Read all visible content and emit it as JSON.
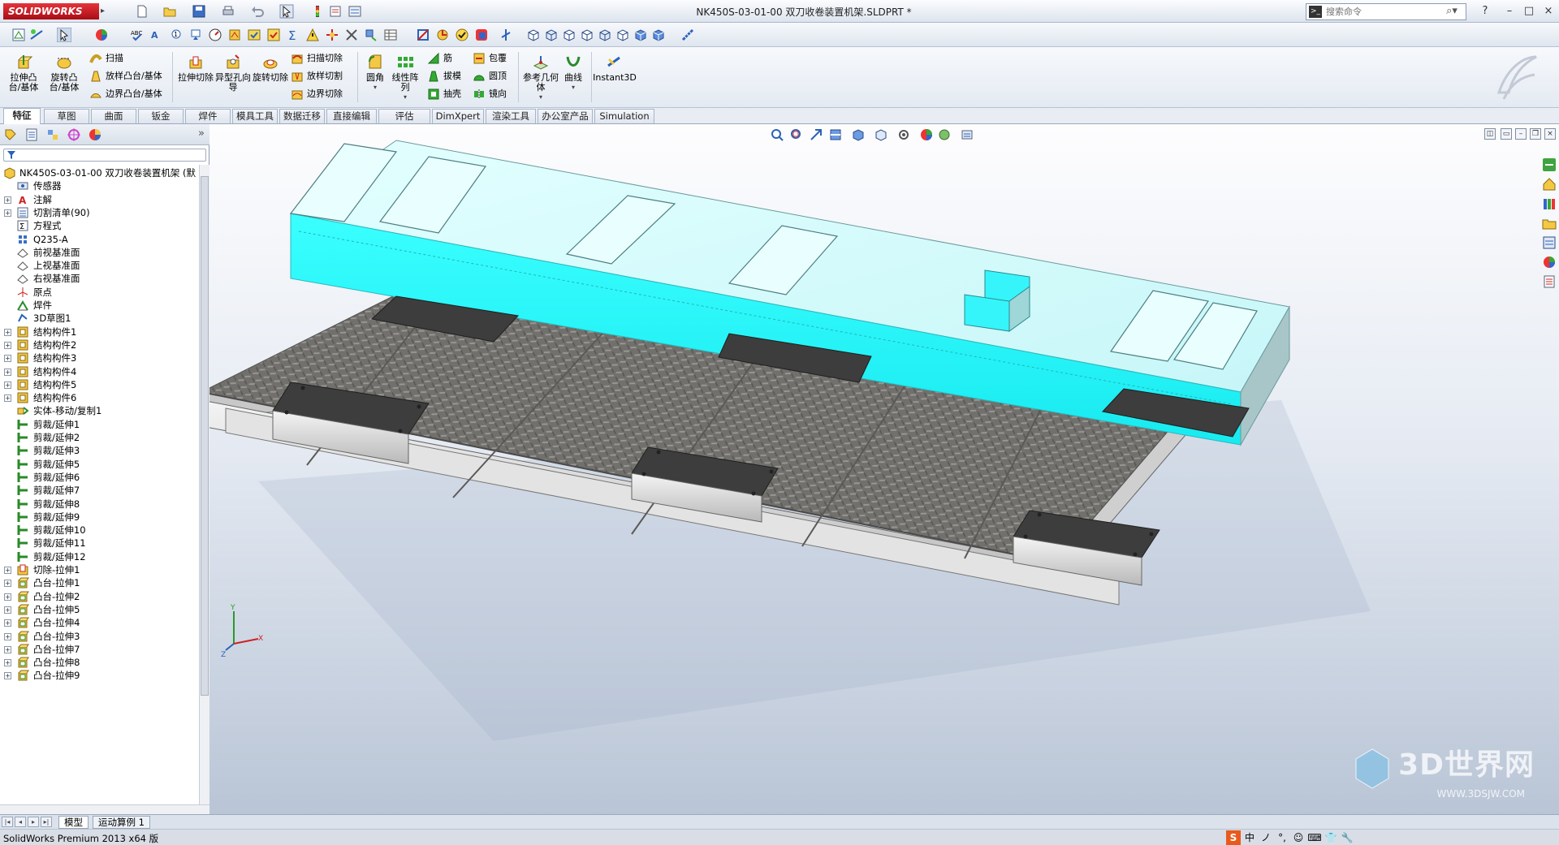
{
  "titlebar": {
    "logo": "SOLIDWORKS",
    "document_title": "NK450S-03-01-00 双刀收卷装置机架.SLDPRT *",
    "search_placeholder": "搜索命令",
    "window_controls": [
      "?",
      "–",
      "□",
      "×"
    ]
  },
  "command_manager": {
    "big_buttons": [
      {
        "label": "拉伸凸台/基体",
        "icon": "extrude-boss-icon"
      },
      {
        "label": "旋转凸台/基体",
        "icon": "revolve-boss-icon"
      },
      {
        "label": "拉伸切除",
        "icon": "extrude-cut-icon"
      },
      {
        "label": "异型孔向导",
        "icon": "hole-wizard-icon"
      },
      {
        "label": "旋转切除",
        "icon": "revolve-cut-icon"
      },
      {
        "label": "圆角",
        "icon": "fillet-icon"
      },
      {
        "label": "线性阵列",
        "icon": "linear-pattern-icon"
      },
      {
        "label": "参考几何体",
        "icon": "reference-geometry-icon"
      },
      {
        "label": "曲线",
        "icon": "curves-icon"
      },
      {
        "label": "Instant3D",
        "icon": "instant3d-icon"
      }
    ],
    "small_buttons": {
      "sweep": "扫描",
      "loft": "放样凸台/基体",
      "boundary": "边界凸台/基体",
      "swept_cut": "扫描切除",
      "lofted_cut": "放样切割",
      "boundary_cut": "边界切除",
      "rib": "筋",
      "draft": "拔模",
      "shell": "抽壳",
      "wrap": "包覆",
      "dome": "圆顶",
      "mirror": "镜向"
    }
  },
  "tabs": [
    {
      "label": "特征",
      "active": true
    },
    {
      "label": "草图"
    },
    {
      "label": "曲面"
    },
    {
      "label": "钣金"
    },
    {
      "label": "焊件"
    },
    {
      "label": "模具工具"
    },
    {
      "label": "数据迁移"
    },
    {
      "label": "直接编辑"
    },
    {
      "label": "评估"
    },
    {
      "label": "DimXpert"
    },
    {
      "label": "渲染工具"
    },
    {
      "label": "办公室产品"
    },
    {
      "label": "Simulation"
    }
  ],
  "feature_tree": {
    "root": "NK450S-03-01-00 双刀收卷装置机架 (默",
    "items": [
      {
        "label": "传感器",
        "icon": "sensor-icon",
        "expandable": false
      },
      {
        "label": "注解",
        "icon": "annotations-icon",
        "expandable": true
      },
      {
        "label": "切割清单(90)",
        "icon": "cut-list-icon",
        "expandable": true
      },
      {
        "label": "方程式",
        "icon": "equations-icon",
        "expandable": false
      },
      {
        "label": "Q235-A",
        "icon": "material-icon",
        "expandable": false
      },
      {
        "label": "前视基准面",
        "icon": "plane-icon",
        "expandable": false
      },
      {
        "label": "上视基准面",
        "icon": "plane-icon",
        "expandable": false
      },
      {
        "label": "右视基准面",
        "icon": "plane-icon",
        "expandable": false
      },
      {
        "label": "原点",
        "icon": "origin-icon",
        "expandable": false
      },
      {
        "label": "焊件",
        "icon": "weldment-icon",
        "expandable": false
      },
      {
        "label": "3D草图1",
        "icon": "sketch3d-icon",
        "expandable": false
      },
      {
        "label": "结构构件1",
        "icon": "structural-member-icon",
        "expandable": true
      },
      {
        "label": "结构构件2",
        "icon": "structural-member-icon",
        "expandable": true
      },
      {
        "label": "结构构件3",
        "icon": "structural-member-icon",
        "expandable": true
      },
      {
        "label": "结构构件4",
        "icon": "structural-member-icon",
        "expandable": true
      },
      {
        "label": "结构构件5",
        "icon": "structural-member-icon",
        "expandable": true
      },
      {
        "label": "结构构件6",
        "icon": "structural-member-icon",
        "expandable": true
      },
      {
        "label": "实体-移动/复制1",
        "icon": "move-copy-icon",
        "expandable": false
      },
      {
        "label": "剪裁/延伸1",
        "icon": "trim-extend-icon",
        "expandable": false
      },
      {
        "label": "剪裁/延伸2",
        "icon": "trim-extend-icon",
        "expandable": false
      },
      {
        "label": "剪裁/延伸3",
        "icon": "trim-extend-icon",
        "expandable": false
      },
      {
        "label": "剪裁/延伸5",
        "icon": "trim-extend-icon",
        "expandable": false
      },
      {
        "label": "剪裁/延伸6",
        "icon": "trim-extend-icon",
        "expandable": false
      },
      {
        "label": "剪裁/延伸7",
        "icon": "trim-extend-icon",
        "expandable": false
      },
      {
        "label": "剪裁/延伸8",
        "icon": "trim-extend-icon",
        "expandable": false
      },
      {
        "label": "剪裁/延伸9",
        "icon": "trim-extend-icon",
        "expandable": false
      },
      {
        "label": "剪裁/延伸10",
        "icon": "trim-extend-icon",
        "expandable": false
      },
      {
        "label": "剪裁/延伸11",
        "icon": "trim-extend-icon",
        "expandable": false
      },
      {
        "label": "剪裁/延伸12",
        "icon": "trim-extend-icon",
        "expandable": false
      },
      {
        "label": "切除-拉伸1",
        "icon": "cut-extrude-icon",
        "expandable": true
      },
      {
        "label": "凸台-拉伸1",
        "icon": "boss-extrude-icon",
        "expandable": true
      },
      {
        "label": "凸台-拉伸2",
        "icon": "boss-extrude-icon",
        "expandable": true
      },
      {
        "label": "凸台-拉伸5",
        "icon": "boss-extrude-icon",
        "expandable": true
      },
      {
        "label": "凸台-拉伸4",
        "icon": "boss-extrude-icon",
        "expandable": true
      },
      {
        "label": "凸台-拉伸3",
        "icon": "boss-extrude-icon",
        "expandable": true
      },
      {
        "label": "凸台-拉伸7",
        "icon": "boss-extrude-icon",
        "expandable": true
      },
      {
        "label": "凸台-拉伸8",
        "icon": "boss-extrude-icon",
        "expandable": true
      },
      {
        "label": "凸台-拉伸9",
        "icon": "boss-extrude-icon",
        "expandable": true
      }
    ]
  },
  "bottom_tabs": [
    "模型",
    "运动算例 1"
  ],
  "status": {
    "text": "SolidWorks Premium 2013 x64 版",
    "ime": [
      "中",
      "ノ",
      "°,",
      "☺",
      "⌨",
      "👕",
      "🔧"
    ]
  },
  "watermark": {
    "text": "3D世界网",
    "url": "WWW.3DSJW.COM"
  },
  "colors": {
    "accent_cyan": "#2effff",
    "top_cover": "#d8ffff",
    "plate": "#6e6a66",
    "pad": "#3d3d3d",
    "logo_red": "#c8161e"
  }
}
